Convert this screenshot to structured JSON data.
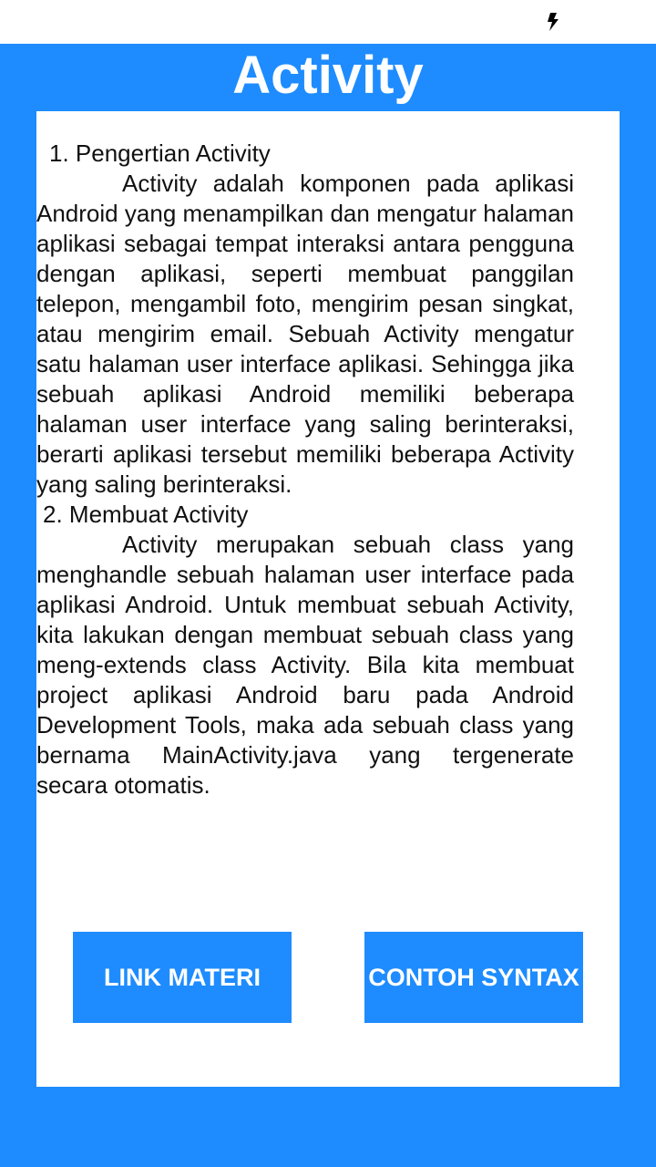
{
  "status_bar": {
    "icon": "flash-icon"
  },
  "header": {
    "title": "Activity"
  },
  "content": {
    "section1_heading": "1. Pengertian Activity",
    "section1_text": "Activity adalah komponen pada aplikasi Android yang menampilkan dan mengatur halaman aplikasi sebagai tempat interaksi antara pengguna dengan aplikasi, seperti membuat panggilan telepon, mengambil foto, mengirim pesan singkat, atau mengirim email. Sebuah Activity mengatur satu halaman user interface aplikasi. Sehingga jika sebuah aplikasi Android memiliki beberapa halaman user interface yang saling berinteraksi, berarti aplikasi tersebut memiliki beberapa Activity yang saling berinteraksi.",
    "section2_heading": "2. Membuat Activity",
    "section2_text": "Activity merupakan sebuah class yang menghandle sebuah halaman user interface pada aplikasi Android. Untuk membuat sebuah Activity, kita lakukan dengan membuat sebuah class yang meng-extends class Activity. Bila kita membuat project aplikasi Android baru pada Android Development Tools, maka ada sebuah class yang bernama MainActivity.java yang tergenerate secara otomatis."
  },
  "buttons": {
    "link_materi": "LINK MATERI",
    "contoh_syntax": "CONTOH SYNTAX"
  },
  "colors": {
    "accent": "#1e8cff",
    "card": "#ffffff",
    "text": "#111111"
  }
}
